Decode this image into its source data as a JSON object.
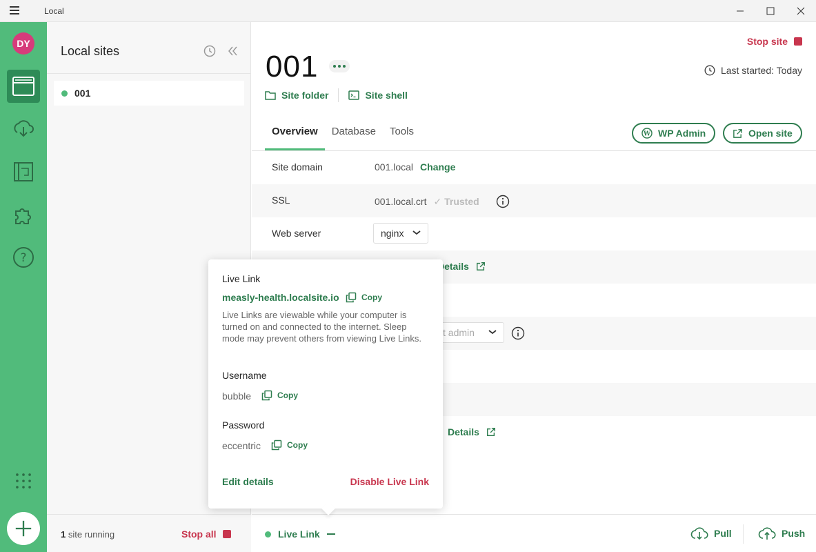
{
  "window": {
    "title": "Local"
  },
  "rail": {
    "avatar_initials": "DY"
  },
  "sites_panel": {
    "title": "Local sites",
    "sites": [
      {
        "name": "001",
        "status": "running"
      }
    ],
    "footer": {
      "running_count": "1",
      "running_text": " site running",
      "stop_all": "Stop all"
    }
  },
  "site": {
    "name": "001",
    "stop_site": "Stop site",
    "last_started_label": "Last started:",
    "last_started_value": "Today",
    "site_folder": "Site folder",
    "site_shell": "Site shell",
    "tabs": [
      "Overview",
      "Database",
      "Tools"
    ],
    "wp_admin": "WP Admin",
    "open_site": "Open site",
    "rows": {
      "domain_label": "Site domain",
      "domain_value": "001.local",
      "domain_change": "Change",
      "ssl_label": "SSL",
      "ssl_value": "001.local.crt",
      "ssl_trusted": "Trusted",
      "webserver_label": "Web server",
      "webserver_value": "nginx",
      "details_1": "Details",
      "admin_placeholder": "ct admin",
      "details_2": "Details"
    }
  },
  "bottom_bar": {
    "live_link": "Live Link",
    "pull": "Pull",
    "push": "Push"
  },
  "popover": {
    "title": "Live Link",
    "url": "measly-health.localsite.io",
    "copy": "Copy",
    "description": "Live Links are viewable while your computer is turned on and connected to the internet. Sleep mode may prevent others from viewing Live Links.",
    "username_label": "Username",
    "username_value": "bubble",
    "password_label": "Password",
    "password_value": "eccentric",
    "edit_details": "Edit details",
    "disable": "Disable Live Link"
  },
  "colors": {
    "brand_green": "#51bb7b",
    "dark_green": "#2e7d4f",
    "stop_red": "#c8364e",
    "avatar_pink": "#d63c7b"
  }
}
